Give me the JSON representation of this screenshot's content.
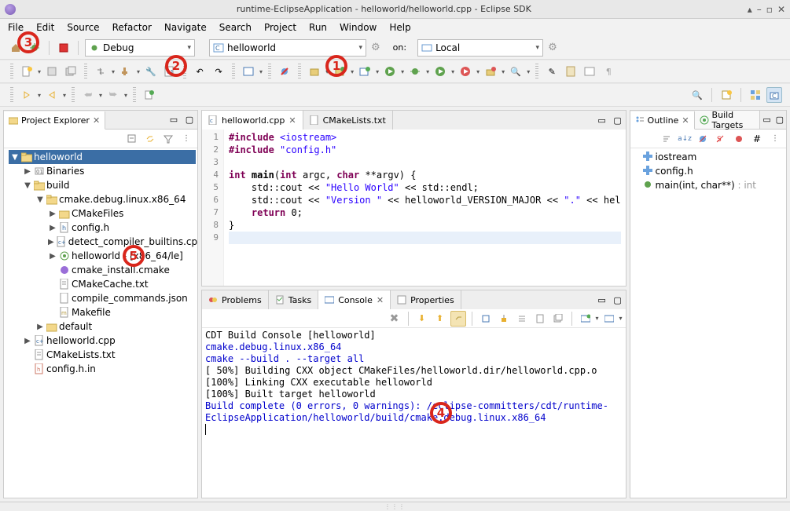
{
  "title": "runtime-EclipseApplication - helloworld/helloworld.cpp - Eclipse SDK",
  "menu": [
    "File",
    "Edit",
    "Source",
    "Refactor",
    "Navigate",
    "Search",
    "Project",
    "Run",
    "Window",
    "Help"
  ],
  "launchbar": {
    "mode": "Debug",
    "config": "helloworld",
    "on_label": "on:",
    "target": "Local"
  },
  "project_explorer": {
    "title": "Project Explorer",
    "root": "helloworld",
    "items": [
      {
        "label": "Binaries",
        "depth": 1,
        "arrow": "▶",
        "icon": "binaries"
      },
      {
        "label": "build",
        "depth": 1,
        "arrow": "▼",
        "icon": "folder-open"
      },
      {
        "label": "cmake.debug.linux.x86_64",
        "depth": 2,
        "arrow": "▼",
        "icon": "folder-open"
      },
      {
        "label": "CMakeFiles",
        "depth": 3,
        "arrow": "▶",
        "icon": "folder"
      },
      {
        "label": "config.h",
        "depth": 3,
        "arrow": "▶",
        "icon": "h-file"
      },
      {
        "label": "detect_compiler_builtins.cpp",
        "depth": 3,
        "arrow": "▶",
        "icon": "cpp-file"
      },
      {
        "label": "helloworld - [x86_64/le]",
        "depth": 3,
        "arrow": "▶",
        "icon": "binary"
      },
      {
        "label": "cmake_install.cmake",
        "depth": 3,
        "arrow": "",
        "icon": "purple-file"
      },
      {
        "label": "CMakeCache.txt",
        "depth": 3,
        "arrow": "",
        "icon": "txt-file"
      },
      {
        "label": "compile_commands.json",
        "depth": 3,
        "arrow": "",
        "icon": "json-file"
      },
      {
        "label": "Makefile",
        "depth": 3,
        "arrow": "",
        "icon": "makefile"
      },
      {
        "label": "default",
        "depth": 2,
        "arrow": "▶",
        "icon": "folder"
      },
      {
        "label": "helloworld.cpp",
        "depth": 1,
        "arrow": "▶",
        "icon": "cpp-file"
      },
      {
        "label": "CMakeLists.txt",
        "depth": 1,
        "arrow": "",
        "icon": "txt-file"
      },
      {
        "label": "config.h.in",
        "depth": 1,
        "arrow": "",
        "icon": "hin-file"
      }
    ]
  },
  "editor": {
    "tabs": [
      {
        "label": "helloworld.cpp",
        "icon": "cpp-file",
        "active": true
      },
      {
        "label": "CMakeLists.txt",
        "icon": "txt-file",
        "active": false
      }
    ],
    "gutter": [
      "1",
      "2",
      "3",
      "4",
      "5",
      "6",
      "7",
      "8",
      "9"
    ]
  },
  "outline": {
    "tabs": [
      "Outline",
      "Build Targets"
    ],
    "items": [
      {
        "label": "iostream",
        "icon": "include"
      },
      {
        "label": "config.h",
        "icon": "include"
      },
      {
        "label": "main(int, char**) : int",
        "icon": "function"
      }
    ]
  },
  "bottom": {
    "tabs": [
      "Problems",
      "Tasks",
      "Console",
      "Properties"
    ],
    "active": 2,
    "console_title": "CDT Build Console [helloworld]",
    "console_lines": [
      {
        "text": "cmake.debug.linux.x86_64",
        "cls": "blue"
      },
      {
        "text": "cmake --build . --target all",
        "cls": "blue"
      },
      {
        "text": "[ 50%] Building CXX object CMakeFiles/helloworld.dir/helloworld.cpp.o",
        "cls": ""
      },
      {
        "text": "[100%] Linking CXX executable helloworld",
        "cls": ""
      },
      {
        "text": "[100%] Built target helloworld",
        "cls": ""
      },
      {
        "text": "Build complete (0 errors, 0 warnings):                                /eclipse-committers/cdt/runtime-EclipseApplication/helloworld/build/cmake.debug.linux.x86_64",
        "cls": "blue"
      }
    ]
  },
  "annotations": {
    "1": "1",
    "2": "2",
    "3": "3",
    "4": "4",
    "5": "5"
  }
}
